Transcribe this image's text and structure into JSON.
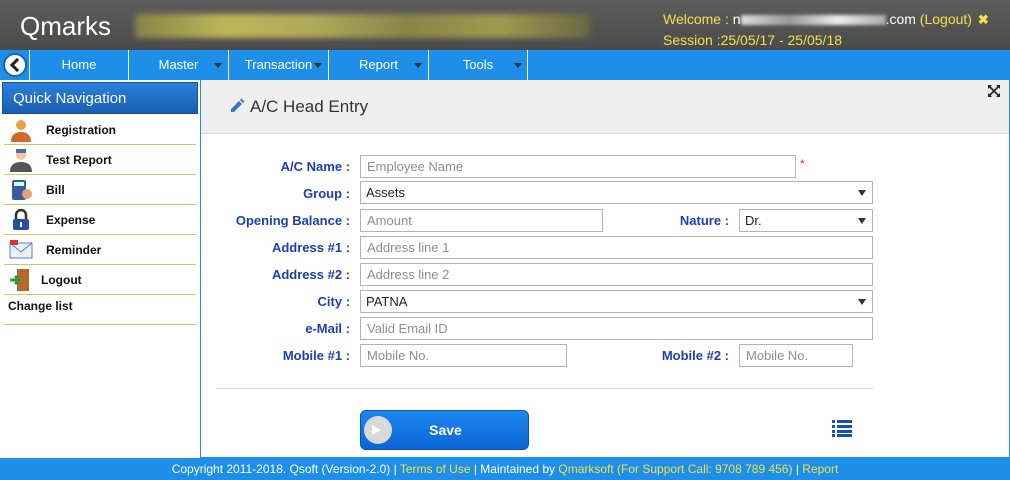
{
  "app": {
    "brand": "Qmarks"
  },
  "header": {
    "welcome_label": "Welcome :",
    "user_prefix": "n",
    "user_suffix": ".com",
    "logout_label": "(Logout)",
    "session": "Session :25/05/17 - 25/05/18"
  },
  "nav": {
    "items": [
      {
        "label": "Home"
      },
      {
        "label": "Master"
      },
      {
        "label": "Transaction"
      },
      {
        "label": "Report"
      },
      {
        "label": "Tools"
      }
    ]
  },
  "sidebar": {
    "title": "Quick Navigation",
    "items": [
      {
        "label": "Registration",
        "icon": "person-icon"
      },
      {
        "label": "Test Report",
        "icon": "doctor-icon"
      },
      {
        "label": "Bill",
        "icon": "calculator-icon"
      },
      {
        "label": "Expense",
        "icon": "lock-icon"
      },
      {
        "label": "Reminder",
        "icon": "mail-icon"
      },
      {
        "label": "Logout",
        "icon": "door-icon"
      }
    ],
    "change_list": "Change list"
  },
  "form": {
    "title": "A/C Head Entry",
    "ac_name": {
      "label": "A/C Name :",
      "placeholder": "Employee Name",
      "required": "*"
    },
    "group": {
      "label": "Group :",
      "value": "Assets"
    },
    "opening_balance": {
      "label": "Opening Balance :",
      "placeholder": "Amount"
    },
    "nature": {
      "label": "Nature :",
      "value": "Dr."
    },
    "address1": {
      "label": "Address #1 :",
      "placeholder": "Address line 1"
    },
    "address2": {
      "label": "Address #2 :",
      "placeholder": "Address line 2"
    },
    "city": {
      "label": "City :",
      "value": "PATNA"
    },
    "email": {
      "label": "e-Mail :",
      "placeholder": "Valid Email ID"
    },
    "mobile1": {
      "label": "Mobile #1 :",
      "placeholder": "Mobile No."
    },
    "mobile2": {
      "label": "Mobile #2 :",
      "placeholder": "Mobile No."
    },
    "save_label": "Save"
  },
  "footer": {
    "copyright": "Copyright 2011-2018. Qsoft (Version-2.0) | ",
    "terms": "Terms of Use",
    "sep1": " | Maintained by ",
    "maintainer": "Qmarksoft (For Support Call: 9708 789 456)",
    "sep2": " | ",
    "report": "Report"
  },
  "colors": {
    "nav": "#1e8fe8",
    "header": "#4f4f4f",
    "accent_text": "#f5e04a",
    "label": "#1d3fb0"
  }
}
